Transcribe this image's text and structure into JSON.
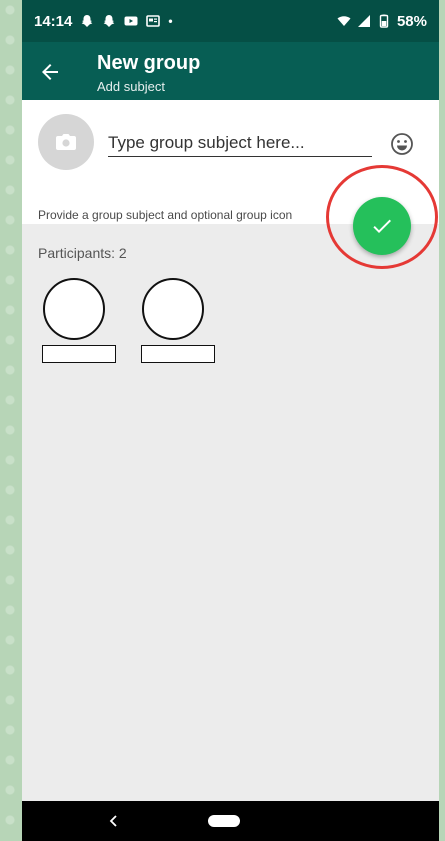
{
  "status_bar": {
    "time": "14:14",
    "battery": "58%"
  },
  "app_bar": {
    "title": "New group",
    "subtitle": "Add subject",
    "back_icon": "arrow-left-icon"
  },
  "subject": {
    "placeholder": "Type group subject here...",
    "value": "",
    "camera_icon": "camera-icon",
    "emoji_icon": "emoji-icon",
    "hint": "Provide a group subject and optional group icon"
  },
  "participants": {
    "label": "Participants: 2",
    "count": 2
  },
  "fab": {
    "icon": "check-icon",
    "color": "#25c05b",
    "highlight_color": "#e53935"
  },
  "colors": {
    "status_bar": "#054f45",
    "app_bar": "#075e54",
    "background": "#ececec"
  }
}
